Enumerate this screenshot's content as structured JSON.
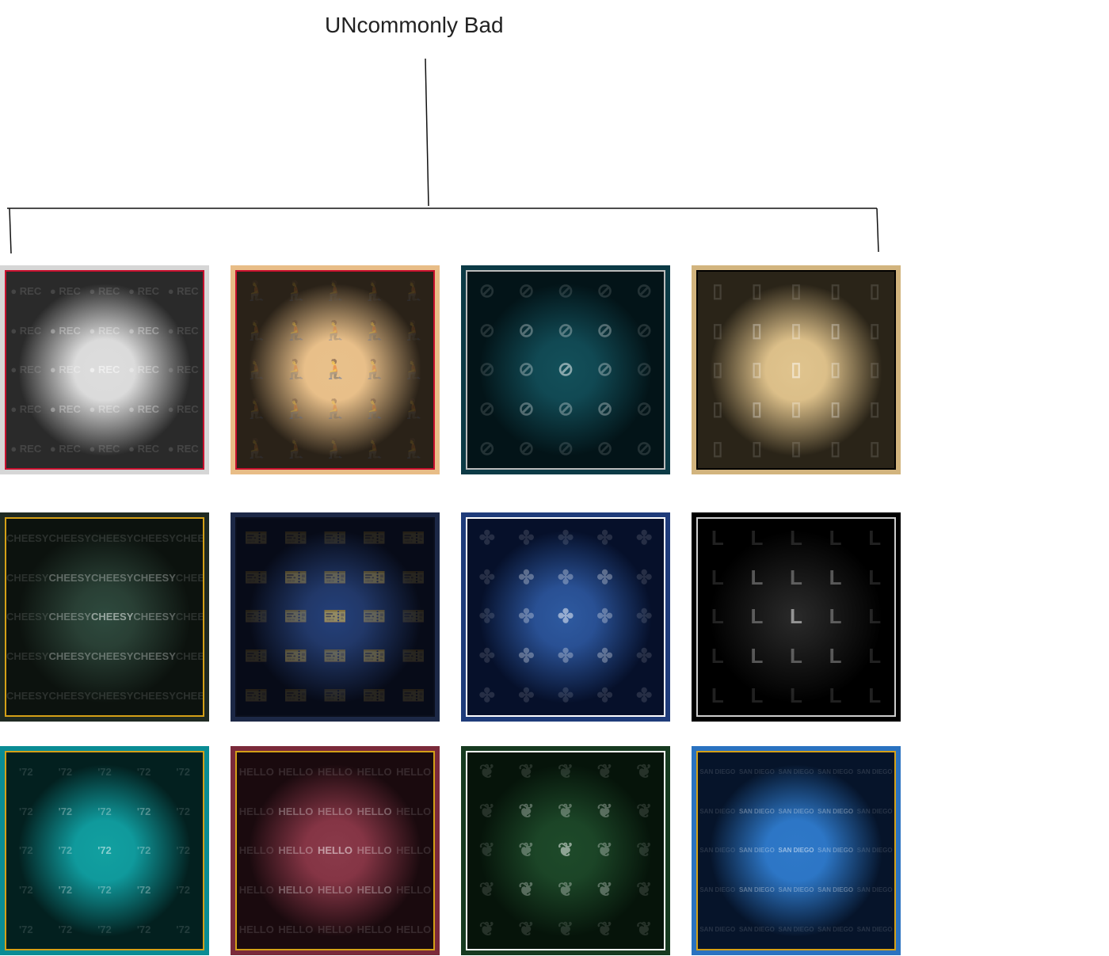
{
  "title": "UNcommonly Bad",
  "tiles": [
    {
      "pattern": "● REC",
      "icon": "rec-icon",
      "outer": "#d6d6d6",
      "border": "#c8102e",
      "bg": "#2a2a2a",
      "glow": "#dddddd"
    },
    {
      "pattern": "🧎",
      "icon": "kneeling-figure-icon",
      "outer": "#e8bd87",
      "border": "#c8102e",
      "bg": "#2a2218",
      "glow": "#e8c08a"
    },
    {
      "pattern": "⊘",
      "icon": "no-hat-icon",
      "outer": "#0c3a45",
      "border": "#bbbbbb",
      "bg": "#031418",
      "glow": "#13505a"
    },
    {
      "pattern": "▯",
      "icon": "toilet-paper-icon",
      "outer": "#d2b47e",
      "border": "#000000",
      "bg": "#2a2418",
      "glow": "#e0c48e"
    },
    {
      "pattern": "CHEESY",
      "icon": "cheesy-text",
      "outer": "#1f2a22",
      "border": "#d4a017",
      "bg": "#0c120e",
      "glow": "#2e4a3e"
    },
    {
      "pattern": "🎫",
      "icon": "ticket-icon",
      "outer": "#1c2846",
      "border": "#0b0f1c",
      "bg": "#070b18",
      "glow": "#24407a"
    },
    {
      "pattern": "✤",
      "icon": "clover-circle-icon",
      "outer": "#1f3c7a",
      "border": "#ffffff",
      "bg": "#06102a",
      "glow": "#2e5aa0"
    },
    {
      "pattern": "L",
      "icon": "letter-l",
      "outer": "#000000",
      "border": "#cccccc",
      "bg": "#000000",
      "glow": "#2a2a2a"
    },
    {
      "pattern": "'72",
      "icon": "palm-tree-72-icon",
      "outer": "#0a8c94",
      "border": "#d4a017",
      "bg": "#03201f",
      "glow": "#12a0a0"
    },
    {
      "pattern": "HELLO",
      "icon": "name-tag-icon",
      "outer": "#7a2a3a",
      "border": "#d4a017",
      "bg": "#1a0a0e",
      "glow": "#8a3a4a"
    },
    {
      "pattern": "❦",
      "icon": "leaf-icon",
      "outer": "#163a20",
      "border": "#ffffff",
      "bg": "#06140a",
      "glow": "#1e4a2a"
    },
    {
      "pattern": "SAN DIEGO",
      "icon": "skyline-icon",
      "outer": "#2a72c0",
      "border": "#d4a017",
      "bg": "#06142a",
      "glow": "#2e78c8"
    }
  ]
}
